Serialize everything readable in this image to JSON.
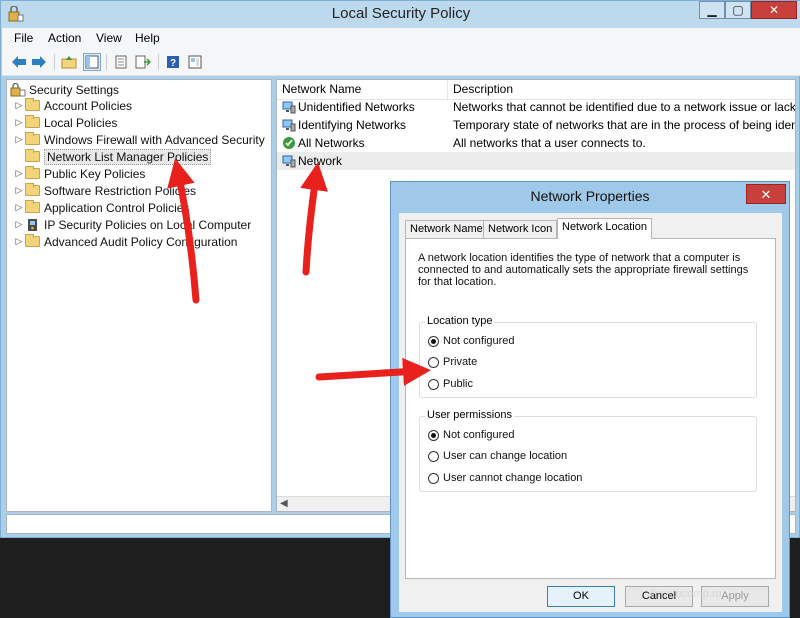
{
  "window": {
    "title": "Local Security Policy",
    "buttons": {
      "minimize": "▁",
      "maximize": "▢",
      "close": "✕"
    }
  },
  "menu": [
    "File",
    "Action",
    "View",
    "Help"
  ],
  "toolbar": {
    "icons": [
      "back-arrow-icon",
      "forward-arrow-icon",
      "up-folder-icon",
      "show-tree-icon",
      "properties-icon",
      "export-list-icon",
      "help-icon",
      "console-view-icon"
    ]
  },
  "tree": {
    "root": "Security Settings",
    "items": [
      {
        "label": "Account Policies",
        "expandable": true
      },
      {
        "label": "Local Policies",
        "expandable": true
      },
      {
        "label": "Windows Firewall with Advanced Security",
        "expandable": true
      },
      {
        "label": "Network List Manager Policies",
        "expandable": false,
        "selected": true
      },
      {
        "label": "Public Key Policies",
        "expandable": true
      },
      {
        "label": "Software Restriction Policies",
        "expandable": true
      },
      {
        "label": "Application Control Policies",
        "expandable": true
      },
      {
        "label": "IP Security Policies on Local Computer",
        "expandable": true
      },
      {
        "label": "Advanced Audit Policy Configuration",
        "expandable": true
      }
    ]
  },
  "list": {
    "columns": [
      "Network Name",
      "Description"
    ],
    "rows": [
      {
        "name": "Unidentified Networks",
        "description": "Networks that cannot be identified due to a network issue or lack of"
      },
      {
        "name": "Identifying Networks",
        "description": "Temporary state of networks that are in the process of being identifi"
      },
      {
        "name": "All Networks",
        "description": "All networks that a user connects to."
      },
      {
        "name": "Network",
        "description": "",
        "selected": true
      }
    ]
  },
  "dialog": {
    "title": "Network Properties",
    "close": "✕",
    "tabs": [
      {
        "label": "Network Name",
        "active": false
      },
      {
        "label": "Network Icon",
        "active": false
      },
      {
        "label": "Network Location",
        "active": true
      }
    ],
    "intro": "A network location identifies the type of network that a computer is connected to and automatically sets the appropriate firewall settings for that location.",
    "location_type": {
      "legend": "Location type",
      "options": [
        {
          "label": "Not configured",
          "checked": true
        },
        {
          "label": "Private",
          "checked": false
        },
        {
          "label": "Public",
          "checked": false
        }
      ]
    },
    "user_permissions": {
      "legend": "User permissions",
      "options": [
        {
          "label": "Not configured",
          "checked": true
        },
        {
          "label": "User can change location",
          "checked": false
        },
        {
          "label": "User cannot change location",
          "checked": false
        }
      ]
    },
    "buttons": {
      "ok": "OK",
      "cancel": "Cancel",
      "apply": "Apply"
    }
  },
  "watermark": "Prostocomp.ru",
  "colors": {
    "window_frame": "#a9cfe9",
    "dialog_frame": "#a0c8e8",
    "close_button": "#c7403b",
    "annotation_arrow": "#e8211d"
  }
}
